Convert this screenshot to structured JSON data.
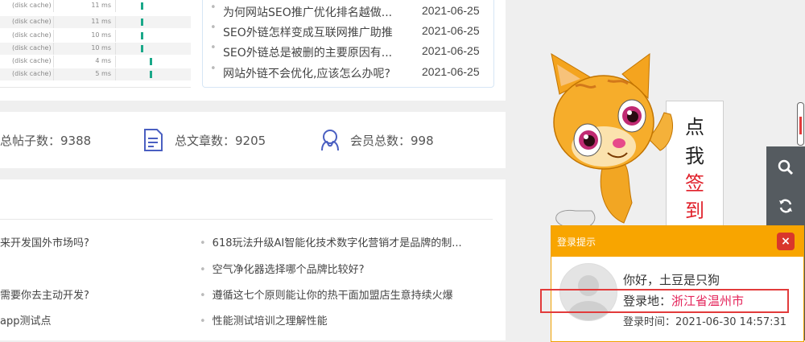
{
  "network": {
    "rows": [
      {
        "src": "(disk cache)",
        "ms": "11 ms",
        "bar": "early"
      },
      {
        "src": "(disk cache)",
        "ms": "11 ms",
        "bar": "early"
      },
      {
        "src": "(disk cache)",
        "ms": "10 ms",
        "bar": "early"
      },
      {
        "src": "(disk cache)",
        "ms": "10 ms",
        "bar": "early"
      },
      {
        "src": "(disk cache)",
        "ms": "4 ms",
        "bar": "late"
      },
      {
        "src": "(disk cache)",
        "ms": "5 ms",
        "bar": "late"
      }
    ]
  },
  "articles": [
    {
      "title": "为何网站SEO推广优化排名越做...",
      "date": "2021-06-25"
    },
    {
      "title": "SEO外链怎样变成互联网推广助推",
      "date": "2021-06-25"
    },
    {
      "title": "SEO外链总是被删的主要原因有...",
      "date": "2021-06-25"
    },
    {
      "title": "网站外链不会优化,应该怎么办呢?",
      "date": "2021-06-25"
    }
  ],
  "stats": {
    "posts": "总帖子数：9388",
    "articles": "总文章数：9205",
    "members": "会员总数：998"
  },
  "list": {
    "left": [
      "来开发国外市场吗?",
      "需要你去主动开发?",
      "app测试点"
    ],
    "right": [
      "618玩法升级AI智能化技术数字化营销才是品牌的制...",
      "空气净化器选择哪个品牌比较好?",
      "遵循这七个原则能让你的热干面加盟店生意持续火爆",
      "性能测试培训之理解性能"
    ]
  },
  "signin": {
    "chars": [
      "点",
      "我",
      "签",
      "到"
    ]
  },
  "popup": {
    "title": "登录提示",
    "close": "×",
    "hello": "你好，土豆是只狗",
    "location_label": "登录地：",
    "location_value": "浙江省温州市",
    "time": "登录时间：2021-06-30 14:57:31"
  },
  "colors": {
    "accent_orange": "#f8a500",
    "highlight_red": "#e23b3b",
    "location_pink": "#e4245a",
    "icon_blue": "#4a5fc1"
  },
  "icons": [
    "document-icon",
    "members-icon",
    "search-icon",
    "refresh-icon",
    "close-icon"
  ]
}
